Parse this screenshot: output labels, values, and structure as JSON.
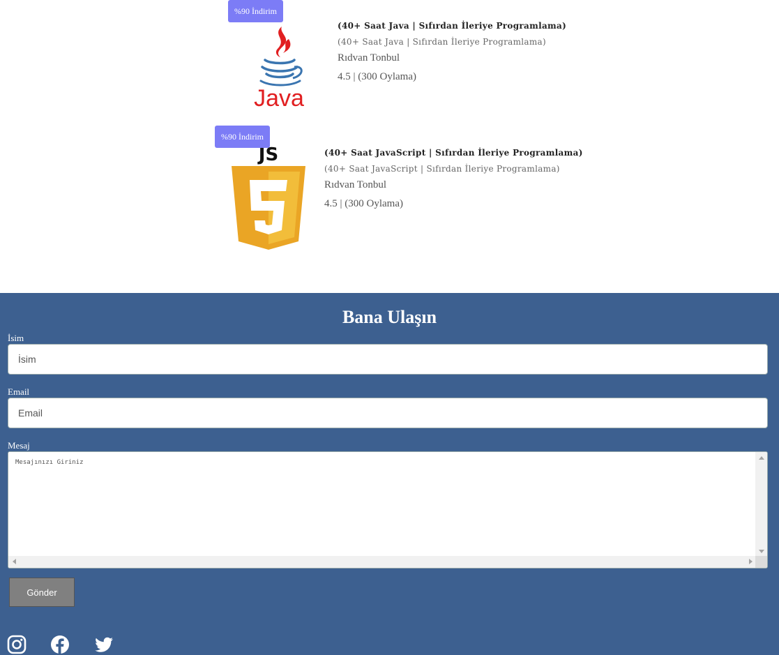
{
  "courses": [
    {
      "badge": "%90 İndirim",
      "logo": "java-logo-icon",
      "logo_text": "Java",
      "title": "(40+ Saat Java | Sıfırdan İleriye Programlama)",
      "subtitle": "(40+ Saat Java | Sıfırdan İleriye Programlama)",
      "author": "Rıdvan Tonbul",
      "rating": "4.5 | (300 Oylama)"
    },
    {
      "badge": "%90 İndirim",
      "logo": "js-shield-logo-icon",
      "logo_text": "JS",
      "title": "(40+ Saat JavaScript | Sıfırdan İleriye Programlama)",
      "subtitle": "(40+ Saat JavaScript | Sıfırdan İleriye Programlama)",
      "author": "Rıdvan Tonbul",
      "rating": "4.5 | (300 Oylama)"
    }
  ],
  "contact": {
    "title": "Bana Ulaşın",
    "name_label": "İsim",
    "name_placeholder": "İsim",
    "email_label": "Email",
    "email_placeholder": "Email",
    "message_label": "Mesaj",
    "message_placeholder": "Mesajınızı Giriniz",
    "submit_label": "Gönder"
  },
  "social": [
    "instagram-icon",
    "facebook-icon",
    "twitter-icon"
  ],
  "colors": {
    "badge": "#7c7cf6",
    "contact_bg": "#3d6090",
    "button": "#808080",
    "java_red": "#e11f21",
    "java_blue": "#3a75b0",
    "js_gold": "#eaa525"
  }
}
